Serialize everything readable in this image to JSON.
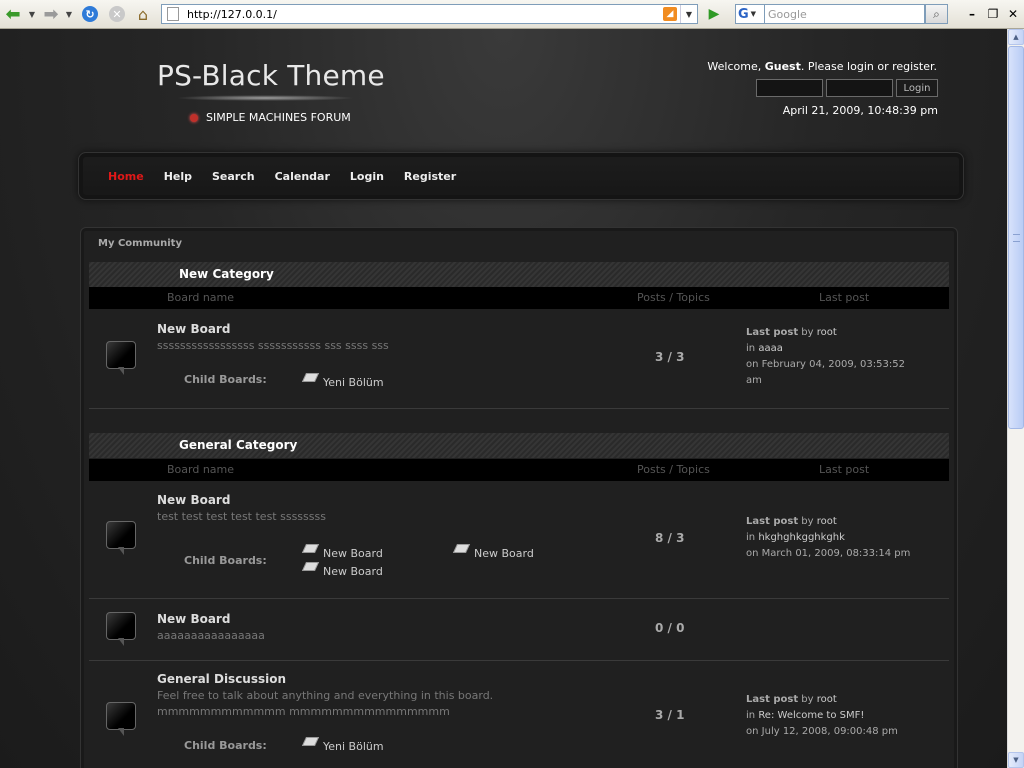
{
  "browser": {
    "url": "http://127.0.0.1/",
    "search_placeholder": "Google",
    "search_engine": "G",
    "login_button_label": "Login"
  },
  "header": {
    "site_title": "PS-Black Theme",
    "tagline": "SIMPLE MACHINES FORUM",
    "welcome_prefix": "Welcome, ",
    "welcome_user": "Guest",
    "welcome_suffix": ". Please login or register.",
    "login_button": "Login",
    "date": "April 21, 2009, 10:48:39 pm"
  },
  "nav": {
    "items": [
      "Home",
      "Help",
      "Search",
      "Calendar",
      "Login",
      "Register"
    ],
    "active": "Home"
  },
  "forum": {
    "community": "My Community",
    "columns": {
      "board": "Board name",
      "posts": "Posts / Topics",
      "last": "Last post"
    },
    "child_boards_label": "Child Boards:",
    "lp_last_post": "Last post",
    "lp_by": "by",
    "lp_in": "in",
    "lp_on": "on",
    "categories": [
      {
        "name": "New Category",
        "boards": [
          {
            "name": "New Board",
            "desc": "sssssssssssssssss sssssssssss sss ssss sss",
            "posts": "3 / 3",
            "children": [
              "Yeni Bölüm"
            ],
            "last_by": "root",
            "last_in": "aaaa",
            "last_on_1": "February 04, 2009, 03:53:52",
            "last_on_2": "am"
          }
        ]
      },
      {
        "name": "General Category",
        "boards": [
          {
            "name": "New Board",
            "desc": "test test test test test ssssssss",
            "posts": "8 / 3",
            "children": [
              "New Board",
              "New Board",
              "New Board"
            ],
            "last_by": "root",
            "last_in": "hkghghkgghkghk",
            "last_on_1": "March 01, 2009, 08:33:14 pm"
          },
          {
            "name": "New Board",
            "desc": "aaaaaaaaaaaaaaaa",
            "posts": "0 / 0"
          },
          {
            "name": "General Discussion",
            "desc": "Feel free to talk about anything and everything in this board.",
            "desc2": "mmmmmmmmmmmm mmmmmmmmmmmmmmm",
            "posts": "3 / 1",
            "children": [
              "Yeni Bölüm"
            ],
            "last_by": "root",
            "last_in": "Re: Welcome to SMF!",
            "last_on_1": "July 12, 2008, 09:00:48 pm"
          }
        ]
      }
    ]
  }
}
